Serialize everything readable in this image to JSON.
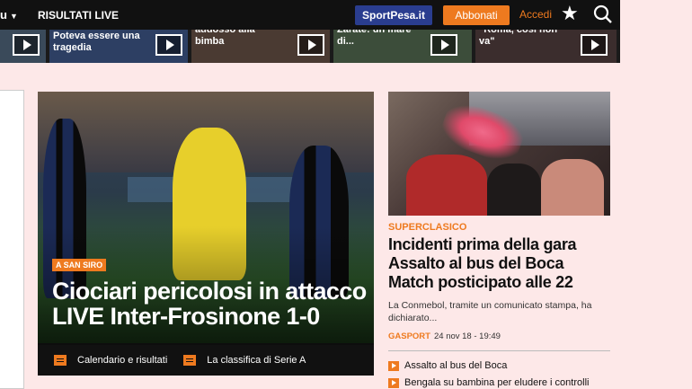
{
  "topbar": {
    "menu_label": "u",
    "results_live": "RISULTATI LIVE",
    "sportpesa": "SportPesa.it",
    "subscribe": "Abbonati",
    "login": "Accedi",
    "icons": [
      "chevron-down-icon",
      "star-icon",
      "search-icon"
    ]
  },
  "video_strip": [
    {
      "text": ""
    },
    {
      "text": "Poteva essere una tragedia"
    },
    {
      "text": "addosso alla bimba"
    },
    {
      "text": "Zarate: un mare di..."
    },
    {
      "text": "\"Roma, così non va\""
    }
  ],
  "main_story": {
    "tag": "A San Siro",
    "title_line1": "Ciociari pericolosi in attacco",
    "title_line2": "LIVE Inter-Frosinone 1-0",
    "links": [
      "Calendario e risultati",
      "La classifica di Serie A"
    ]
  },
  "side_story": {
    "tag": "SUPERCLASICO",
    "title_line1": "Incidenti prima della gara",
    "title_line2": "Assalto al bus del Boca",
    "title_line3": "Match posticipato alle 22",
    "description": "La Conmebol, tramite un comunicato stampa, ha dichiarato...",
    "source": "GASPORT",
    "timestamp": "24 nov 18 - 19:49",
    "related": [
      "Assalto al bus del Boca",
      "Bengala su bambina per eludere i controlli"
    ]
  },
  "colors": {
    "accent": "#ee7a1f",
    "brand_blue": "#2a3d8f",
    "topbar": "#111111",
    "page_bg": "#fde8e8"
  }
}
